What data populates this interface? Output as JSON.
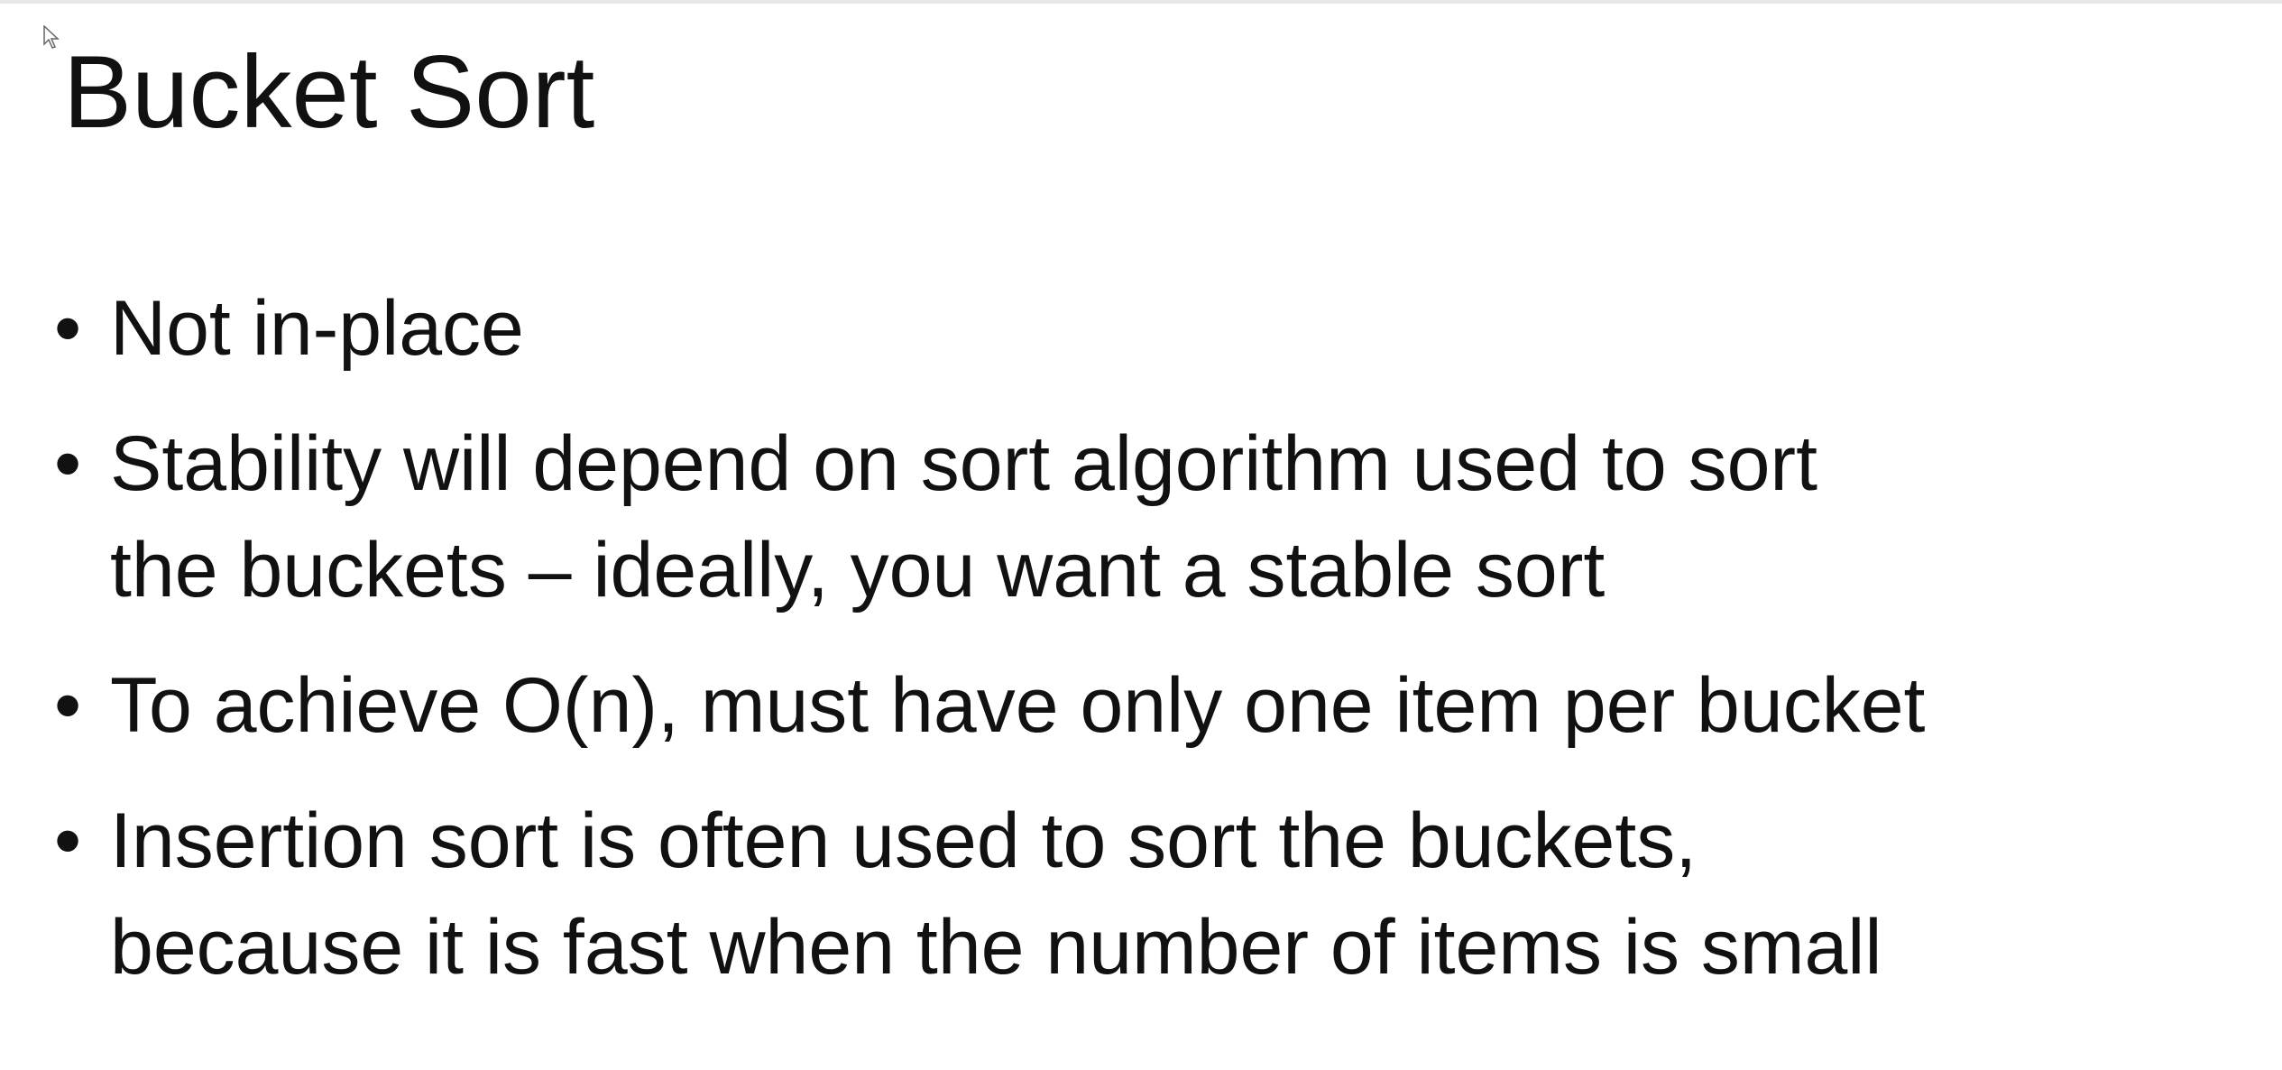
{
  "slide": {
    "title": "Bucket Sort",
    "bullet_symbol": "•",
    "bullets": [
      {
        "text": "Not in-place"
      },
      {
        "text": "Stability will depend on sort algorithm used to sort\nthe buckets – ideally, you want a stable sort"
      },
      {
        "text": "To achieve O(n), must have only one item per bucket"
      },
      {
        "text": "Insertion sort is often used to sort the buckets,\nbecause it is fast when the number of items is small"
      }
    ]
  },
  "colors": {
    "background": "#ffffff",
    "text": "#111111"
  },
  "icons": {
    "cursor": "mouse-pointer-icon"
  }
}
